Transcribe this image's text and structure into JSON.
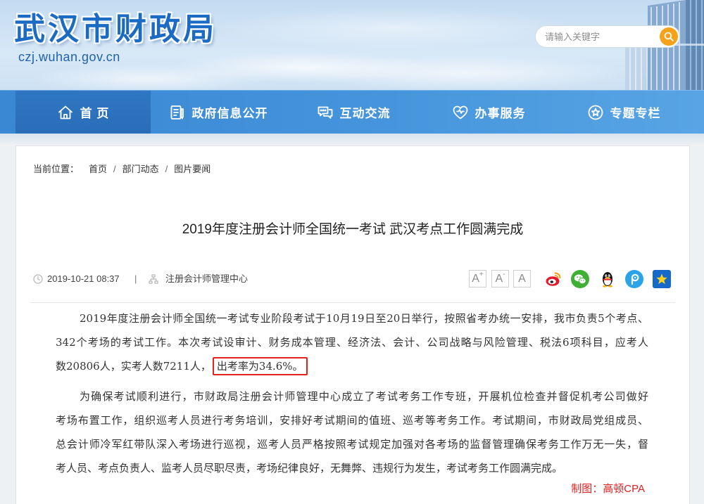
{
  "site": {
    "title": "武汉市财政局",
    "domain": "czj.wuhan.gov.cn"
  },
  "search": {
    "placeholder": "请输入关键字",
    "button_icon": "search-icon"
  },
  "nav": [
    {
      "label": "首 页",
      "icon": "home-icon",
      "active": true
    },
    {
      "label": "政府信息公开",
      "icon": "document-list-icon",
      "active": false
    },
    {
      "label": "互动交流",
      "icon": "chat-bubbles-icon",
      "active": false
    },
    {
      "label": "办事服务",
      "icon": "heart-icon",
      "active": false
    },
    {
      "label": "专题专栏",
      "icon": "star-circle-icon",
      "active": false
    }
  ],
  "breadcrumb": {
    "prefix": "当前位置：",
    "separator": "/",
    "items": [
      "首页",
      "部门动态",
      "图片要闻"
    ]
  },
  "article": {
    "title": "2019年度注册会计师全国统一考试 武汉考点工作圆满完成",
    "meta": {
      "date_icon": "clock-icon",
      "date": "2019-10-21 08:37",
      "divider": "|",
      "source_icon": "org-chart-icon",
      "source": "注册会计师管理中心"
    },
    "font_size_buttons": [
      {
        "letter": "A",
        "sup": "+"
      },
      {
        "letter": "A",
        "sup": "-"
      },
      {
        "letter": "A",
        "sup": ""
      }
    ],
    "share_icons": [
      "weibo-icon",
      "wechat-icon",
      "qq-icon",
      "tencent-weibo-icon",
      "qzone-icon"
    ],
    "paragraphs": [
      {
        "lines": [
          "2019年度注册会计师全国统一考试专业阶段考试于10月19日至20日举行，按照省考办统一安排，我市负责5个考点、",
          "342个考场的考试工作。本次考试设审计、财务成本管理、经济法、会计、公司战略与风险管理、税法6项科目，应考人",
          "数20806人，实考人数7211人，"
        ],
        "highlight": "出考率为34.6%。"
      },
      {
        "lines": [
          "为确保考试顺利进行，市财政局注册会计师管理中心成立了考试考务工作专班，开展机位检查并督促机考公司做好",
          "考场布置工作，组织巡考人员进行考务培训，安排好考试期间的值班、巡考等考务工作。考试期间，市财政局党组成员、",
          "总会计师冷军红带队深入考场进行巡视，巡考人员严格按照考试规定加强对各考场的监督管理确保考务工作万无一失，督",
          "考人员、考点负责人、监考人员尽职尽责，考场纪律良好，无舞弊、违规行为发生，考试考务工作圆满完成。"
        ]
      }
    ],
    "credit": "制图：高顿CPA"
  },
  "colors": {
    "brand_blue": "#1b6ac4",
    "nav_blue": "#3a87d3",
    "nav_active": "#2a6db8",
    "search_button": "#f5a11a",
    "highlight_border": "#e2231a",
    "credit_red": "#e02020"
  }
}
